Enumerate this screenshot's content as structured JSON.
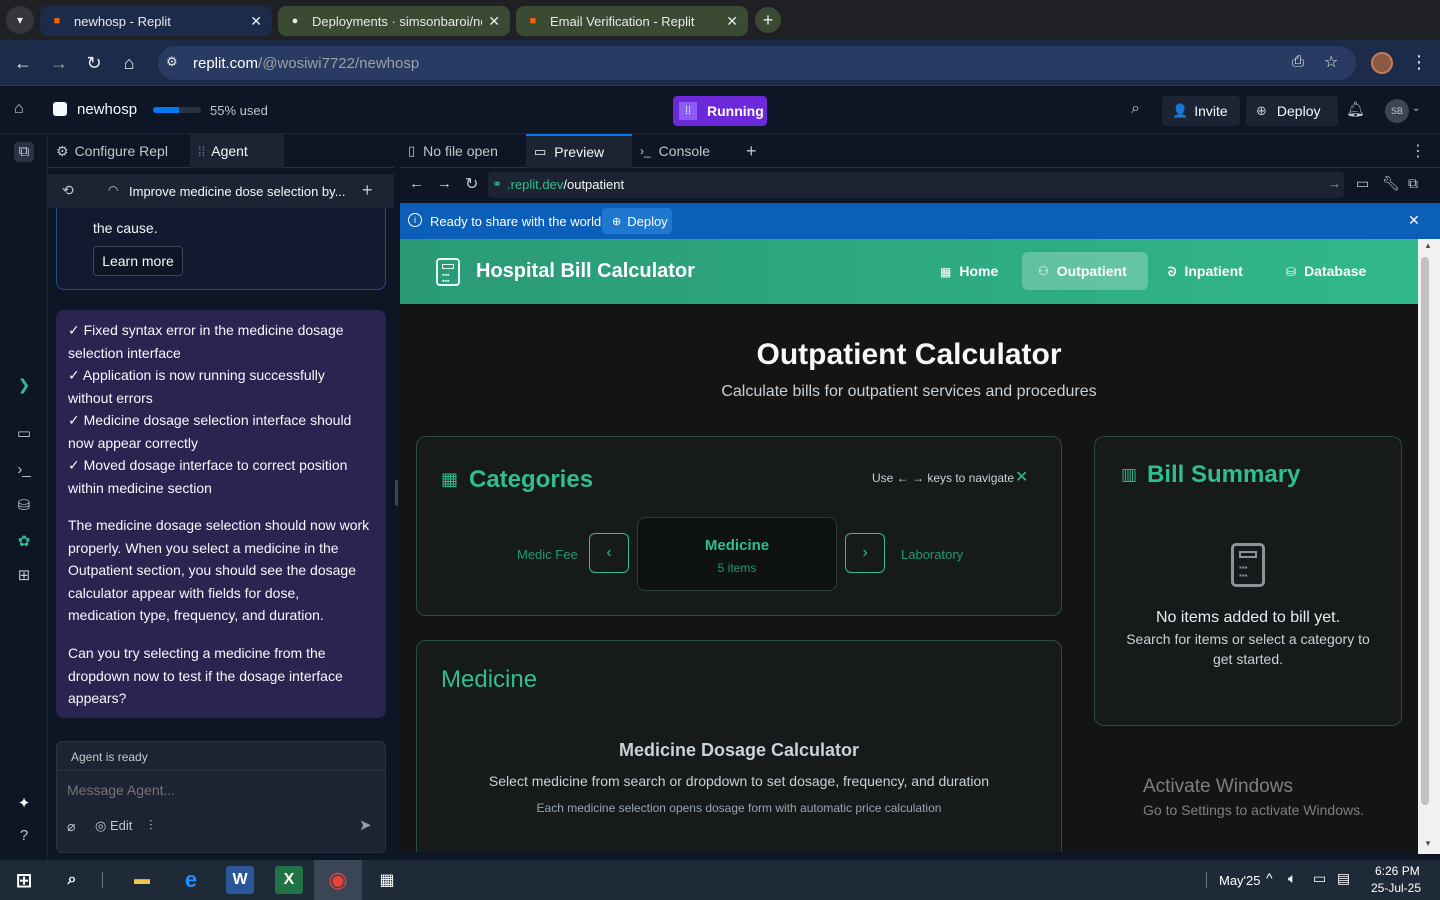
{
  "browser": {
    "tabs": [
      {
        "title": "newhosp - Replit"
      },
      {
        "title": "Deployments · simsonbaroi/nev"
      },
      {
        "title": "Email Verification - Replit"
      }
    ],
    "url_host": "replit.com",
    "url_path": "/@wosiwi7722/newhosp"
  },
  "replit": {
    "project_name": "newhosp",
    "usage_percent": 55,
    "usage_label": "55% used",
    "status": "Running",
    "invite_label": "Invite",
    "deploy_label": "Deploy",
    "avatar_initials": "SB"
  },
  "agent_panel": {
    "tab_configure": "Configure Repl",
    "tab_agent": "Agent",
    "thread_title": "Improve medicine dose selection by...",
    "prev_text": "the cause.",
    "learn_more": "Learn more",
    "checklist": [
      "✓ Fixed syntax error in the medicine dosage",
      "selection interface",
      "✓ Application is now running successfully",
      "without errors",
      "✓ Medicine dosage selection interface should",
      "now appear correctly",
      "✓ Moved dosage interface to correct position",
      "within medicine section"
    ],
    "paragraph1": [
      "The medicine dosage selection should now work",
      "properly. When you select a medicine in the",
      "Outpatient section, you should see the dosage",
      "calculator appear with fields for dose,",
      "medication type, frequency, and duration."
    ],
    "paragraph2": [
      "Can you try selecting a medicine from the",
      "dropdown now to test if the dosage interface",
      "appears?"
    ],
    "status_text": "Agent is ready",
    "input_placeholder": "Message Agent...",
    "edit_label": "Edit"
  },
  "workspace_tabs": {
    "no_file": "No file open",
    "preview": "Preview",
    "console": "Console"
  },
  "preview_bar": {
    "url_domain": ".replit.dev",
    "url_path": "/outpatient",
    "share_text": "Ready to share with the world?",
    "deploy_label": "Deploy"
  },
  "app": {
    "title": "Hospital Bill Calculator",
    "nav": [
      "Home",
      "Outpatient",
      "Inpatient",
      "Database"
    ],
    "heading": "Outpatient Calculator",
    "subheading": "Calculate bills for outpatient services and procedures",
    "categories_title": "Categories",
    "nav_hint": "Use ← → keys to navigate",
    "cat_prev": "Medic Fee",
    "cat_current": "Medicine",
    "cat_current_count": "5 items",
    "cat_next": "Laboratory",
    "summary_title": "Bill Summary",
    "summary_empty": "No items added to bill yet.",
    "summary_hint_1": "Search for items or select a category to",
    "summary_hint_2": "get started.",
    "medicine_title": "Medicine",
    "dosage_title": "Medicine Dosage Calculator",
    "dosage_desc": "Select medicine from search or dropdown to set dosage, frequency, and duration",
    "dosage_note": "Each medicine selection opens dosage form with automatic price calculation"
  },
  "watermark": {
    "line1": "Activate Windows",
    "line2": "Go to Settings to activate Windows."
  },
  "taskbar": {
    "weather": "May'25",
    "time": "6:26 PM",
    "date": "25-Jul-25"
  },
  "colors": {
    "accent_green": "#2fbf8f",
    "replit_purple": "#7c3aed",
    "share_bar": "#0b5fb8"
  }
}
